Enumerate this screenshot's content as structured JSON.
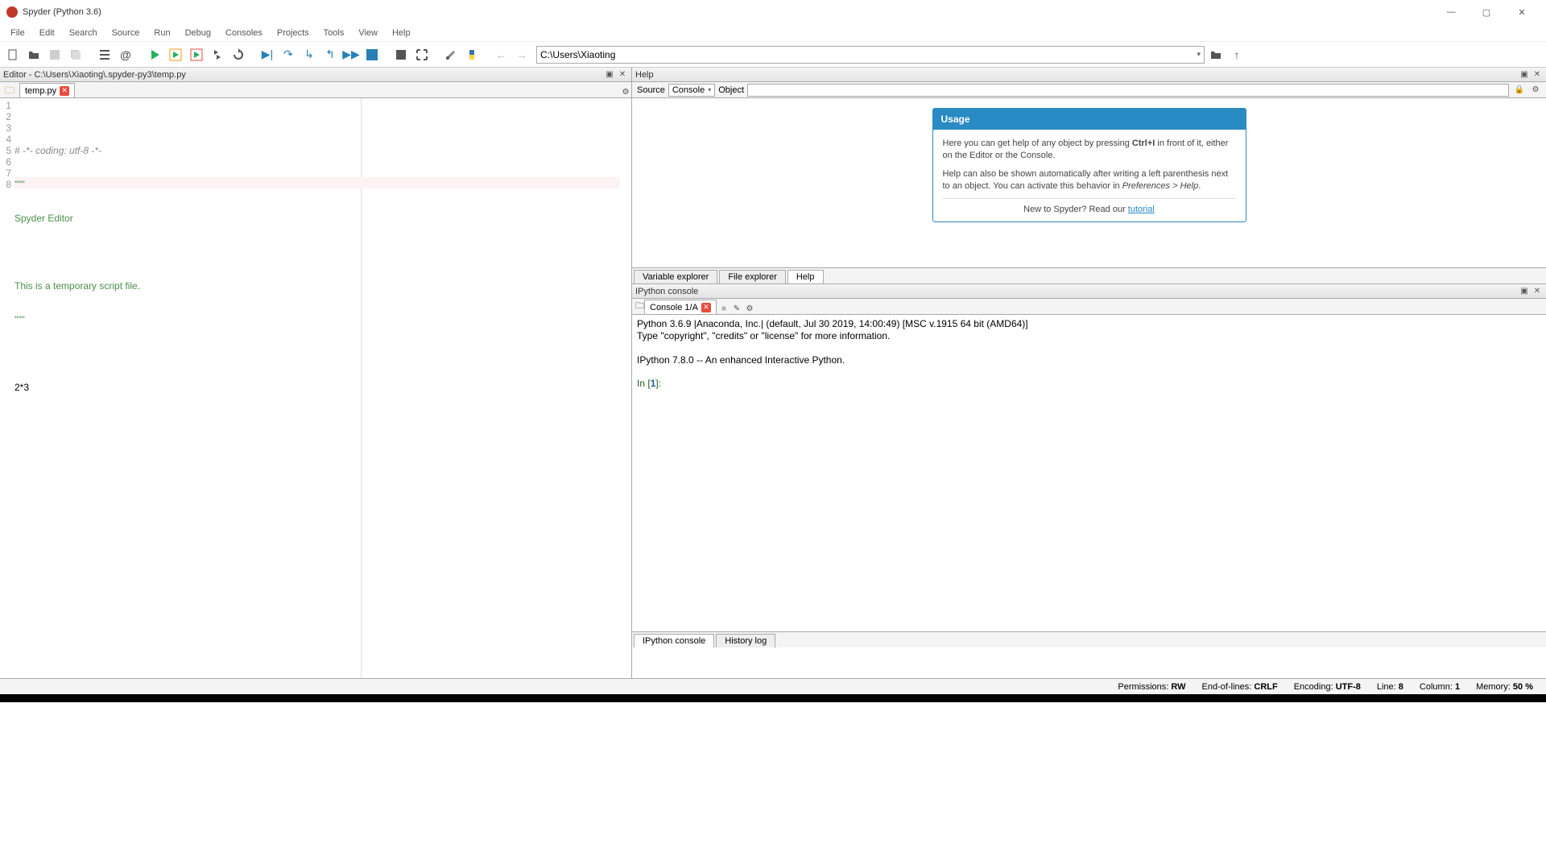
{
  "title": "Spyder (Python 3.6)",
  "menus": [
    "File",
    "Edit",
    "Search",
    "Source",
    "Run",
    "Debug",
    "Consoles",
    "Projects",
    "Tools",
    "View",
    "Help"
  ],
  "path": "C:\\Users\\Xiaoting",
  "editor": {
    "header": "Editor - C:\\Users\\Xiaoting\\.spyder-py3\\temp.py",
    "tab": "temp.py",
    "lines": [
      {
        "n": "1",
        "cls": "c-comment",
        "t": "# -*- coding: utf-8 -*-"
      },
      {
        "n": "2",
        "cls": "c-str",
        "t": "\"\"\""
      },
      {
        "n": "3",
        "cls": "c-str",
        "t": "Spyder Editor"
      },
      {
        "n": "4",
        "cls": "c-str",
        "t": ""
      },
      {
        "n": "5",
        "cls": "c-str",
        "t": "This is a temporary script file."
      },
      {
        "n": "6",
        "cls": "c-str",
        "t": "\"\"\""
      },
      {
        "n": "7",
        "cls": "c-code",
        "t": ""
      },
      {
        "n": "8",
        "cls": "c-code",
        "t": "2*3"
      }
    ]
  },
  "help": {
    "header": "Help",
    "source_label": "Source",
    "source_value": "Console",
    "object_label": "Object",
    "usage_title": "Usage",
    "usage_p1a": "Here you can get help of any object by pressing ",
    "usage_p1b": "Ctrl+I",
    "usage_p1c": " in front of it, either on the Editor or the Console.",
    "usage_p2a": "Help can also be shown automatically after writing a left parenthesis next to an object. You can activate this behavior in ",
    "usage_p2b": "Preferences > Help",
    "usage_p2c": ".",
    "tutorial_pre": "New to Spyder? Read our ",
    "tutorial_link": "tutorial",
    "bottom_tabs": [
      "Variable explorer",
      "File explorer",
      "Help"
    ]
  },
  "console": {
    "header": "IPython console",
    "tab": "Console 1/A",
    "out": "Python 3.6.9 |Anaconda, Inc.| (default, Jul 30 2019, 14:00:49) [MSC v.1915 64 bit (AMD64)]\nType \"copyright\", \"credits\" or \"license\" for more information.\n\nIPython 7.8.0 -- An enhanced Interactive Python.\n",
    "prompt_pre": "In [",
    "prompt_num": "1",
    "prompt_post": "]: ",
    "bottom_tabs": [
      "IPython console",
      "History log"
    ]
  },
  "status": {
    "perm_l": "Permissions:",
    "perm_v": "RW",
    "eol_l": "End-of-lines:",
    "eol_v": "CRLF",
    "enc_l": "Encoding:",
    "enc_v": "UTF-8",
    "line_l": "Line:",
    "line_v": "8",
    "col_l": "Column:",
    "col_v": "1",
    "mem_l": "Memory:",
    "mem_v": "50 %"
  }
}
